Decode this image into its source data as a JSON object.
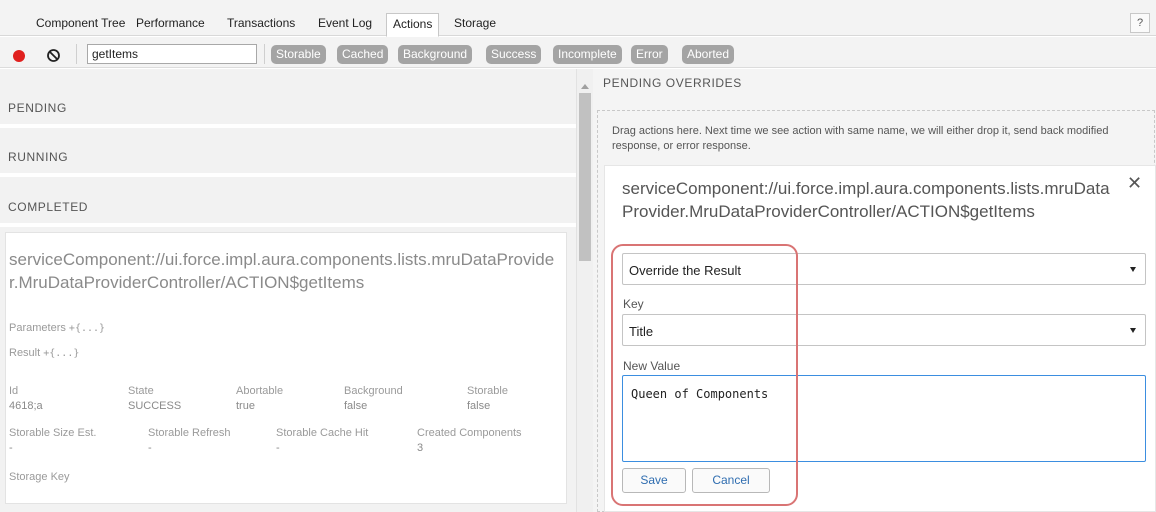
{
  "tabs": [
    {
      "label": "Component Tree"
    },
    {
      "label": "Performance"
    },
    {
      "label": "Transactions"
    },
    {
      "label": "Event Log"
    },
    {
      "label": "Actions"
    },
    {
      "label": "Storage"
    }
  ],
  "active_tab": "Actions",
  "help_label": "?",
  "toolbar": {
    "filter_value": "getItems",
    "filters": [
      "Storable",
      "Cached",
      "Background",
      "Success",
      "Incomplete",
      "Error",
      "Aborted"
    ]
  },
  "sections": {
    "pending": "PENDING",
    "running": "RUNNING",
    "completed": "COMPLETED"
  },
  "action": {
    "name": "serviceComponent://ui.force.impl.aura.components.lists.mruDataProvider.MruDataProviderController/ACTION$getItems",
    "parameters_label": "Parameters",
    "parameters_value": "+{...}",
    "result_label": "Result",
    "result_value": "+{...}",
    "row1": {
      "labels": [
        "Id",
        "State",
        "Abortable",
        "Background",
        "Storable"
      ],
      "values": [
        "4618;a",
        "SUCCESS",
        "true",
        "false",
        "false"
      ]
    },
    "row2": {
      "labels": [
        "Storable Size Est.",
        "Storable Refresh",
        "Storable Cache Hit",
        "Created Components"
      ],
      "values": [
        "-",
        "-",
        "-",
        "3"
      ]
    },
    "storage_key_label": "Storage Key"
  },
  "overrides": {
    "title": "PENDING OVERRIDES",
    "hint": "Drag actions here. Next time we see action with same name, we will either drop it, send back modified response, or error response.",
    "action_name": "serviceComponent://ui.force.impl.aura.components.lists.mruDataProvider.MruDataProviderController/ACTION$getItems",
    "close_label": "✕",
    "mode_value": "Override the Result",
    "key_label": "Key",
    "key_value": "Title",
    "new_value_label": "New Value",
    "new_value": "Queen of Components",
    "save_label": "Save",
    "cancel_label": "Cancel"
  },
  "colors": {
    "record": "#e0201e",
    "chip": "#a4a4a4",
    "highlight": "#d97474",
    "focus": "#3b8ee0",
    "button_text": "#2f6db0"
  }
}
